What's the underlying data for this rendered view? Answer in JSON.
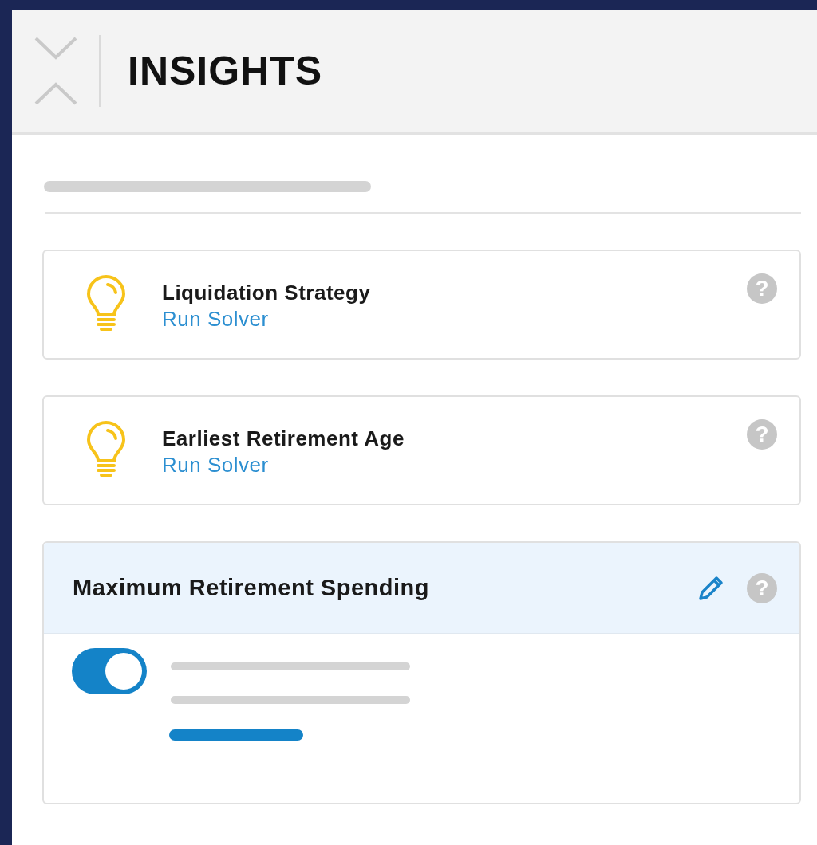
{
  "header": {
    "title": "INSIGHTS"
  },
  "insights": [
    {
      "title": "Liquidation Strategy",
      "link": "Run Solver",
      "help": "?"
    },
    {
      "title": "Earliest Retirement Age",
      "link": "Run Solver",
      "help": "?"
    }
  ],
  "feature": {
    "title": "Maximum Retirement Spending",
    "help": "?",
    "toggle": {
      "on": true
    }
  }
}
